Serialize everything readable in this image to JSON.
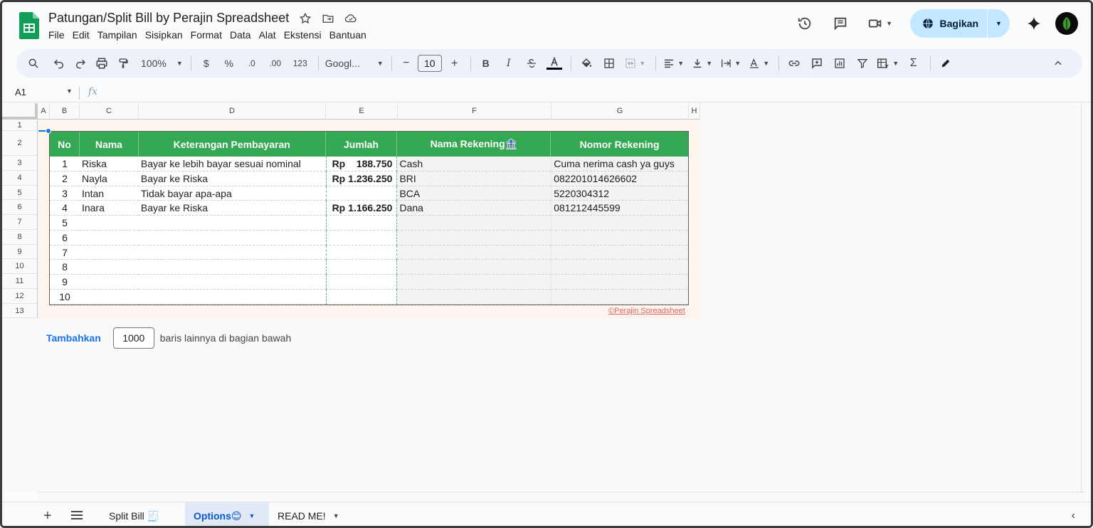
{
  "doc": {
    "title": "Patungan/Split Bill by Perajin Spreadsheet",
    "menu": [
      "File",
      "Edit",
      "Tampilan",
      "Sisipkan",
      "Format",
      "Data",
      "Alat",
      "Ekstensi",
      "Bantuan"
    ],
    "share_label": "Bagikan"
  },
  "toolbar": {
    "zoom": "100%",
    "currency": "$",
    "percent": "%",
    "dec_less": ".0",
    "dec_more": ".00",
    "num_format": "123",
    "font": "Googl...",
    "font_size": "10",
    "minus": "−",
    "plus": "+",
    "bold": "B",
    "italic": "I",
    "sigma": "Σ"
  },
  "formula_bar": {
    "cell_ref": "A1",
    "fx": "fx"
  },
  "columns": [
    "A",
    "B",
    "C",
    "D",
    "E",
    "F",
    "G",
    "H"
  ],
  "rows": [
    "1",
    "2",
    "3",
    "4",
    "5",
    "6",
    "7",
    "8",
    "9",
    "10",
    "11",
    "12",
    "13"
  ],
  "table": {
    "headers": [
      "No",
      "Nama",
      "Keterangan Pembayaran",
      "Jumlah",
      "Nama Rekening🏦",
      "Nomor Rekening"
    ],
    "rows": [
      {
        "no": "1",
        "nama": "Riska",
        "ket": "Bayar ke lebih bayar sesuai nominal",
        "rp": "Rp",
        "jumlah": "188.750",
        "rek": "Cash",
        "nomor": "Cuma nerima cash ya guys"
      },
      {
        "no": "2",
        "nama": "Nayla",
        "ket": "Bayar ke Riska",
        "rp": "Rp",
        "jumlah": "1.236.250",
        "rek": "BRI",
        "nomor": "082201014626602"
      },
      {
        "no": "3",
        "nama": "Intan",
        "ket": "Tidak bayar apa-apa",
        "rp": "",
        "jumlah": "",
        "rek": "BCA",
        "nomor": "5220304312"
      },
      {
        "no": "4",
        "nama": "Inara",
        "ket": "Bayar ke Riska",
        "rp": "Rp",
        "jumlah": "1.166.250",
        "rek": "Dana",
        "nomor": "081212445599"
      },
      {
        "no": "5",
        "nama": "",
        "ket": "",
        "rp": "",
        "jumlah": "",
        "rek": "",
        "nomor": ""
      },
      {
        "no": "6",
        "nama": "",
        "ket": "",
        "rp": "",
        "jumlah": "",
        "rek": "",
        "nomor": ""
      },
      {
        "no": "7",
        "nama": "",
        "ket": "",
        "rp": "",
        "jumlah": "",
        "rek": "",
        "nomor": ""
      },
      {
        "no": "8",
        "nama": "",
        "ket": "",
        "rp": "",
        "jumlah": "",
        "rek": "",
        "nomor": ""
      },
      {
        "no": "9",
        "nama": "",
        "ket": "",
        "rp": "",
        "jumlah": "",
        "rek": "",
        "nomor": ""
      },
      {
        "no": "10",
        "nama": "",
        "ket": "",
        "rp": "",
        "jumlah": "",
        "rek": "",
        "nomor": ""
      }
    ],
    "credit": "©Perajin Spreadsheet"
  },
  "add_rows": {
    "button": "Tambahkan",
    "count": "1000",
    "suffix": "baris lainnya di bagian bawah"
  },
  "tabs": [
    {
      "label": "Split Bill 🧾",
      "color": "#4a7ba8"
    },
    {
      "label": "Options😊",
      "color": "#34a853"
    },
    {
      "label": "READ ME!",
      "color": "#e06666"
    }
  ],
  "colors": {
    "header_green": "#34a853",
    "share_bg": "#c2e7ff",
    "accent_blue": "#1a73e8"
  }
}
